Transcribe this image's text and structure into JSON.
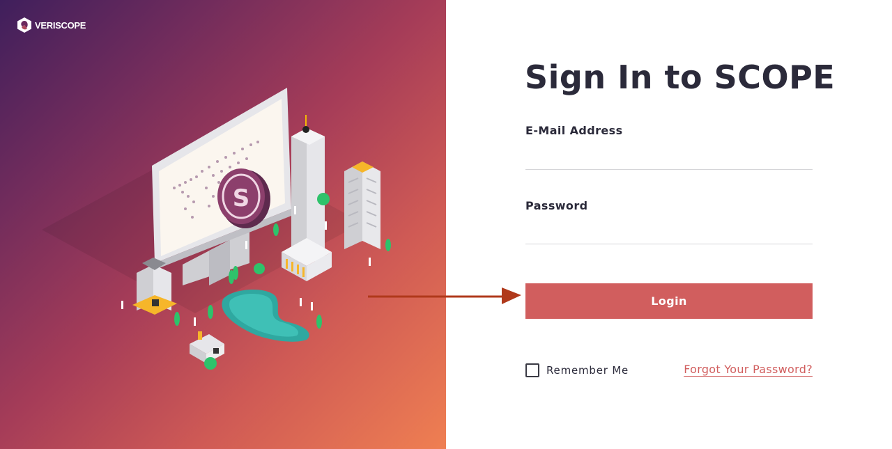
{
  "brand": {
    "logo_text": "VERISCOPE",
    "icon": "veriscope-logo-icon"
  },
  "form": {
    "title": "Sign In to SCOPE",
    "email_label": "E-Mail Address",
    "email_value": "",
    "password_label": "Password",
    "password_value": "",
    "login_label": "Login",
    "remember_label": "Remember Me",
    "remember_checked": false,
    "forgot_label": "Forgot Your Password?"
  },
  "colors": {
    "accent": "#d15e5e",
    "title_text": "#2b2a3a",
    "gradient_start": "#3f1f5c",
    "gradient_end": "#ef7f52",
    "arrow": "#b0391b"
  },
  "illustration": {
    "icon": "isometric-city-monitor-illustration"
  }
}
